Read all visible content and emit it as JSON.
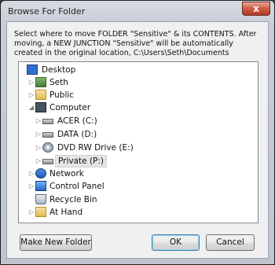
{
  "window": {
    "title": "Browse For Folder",
    "close_glyph": "x"
  },
  "description": "Select where to move FOLDER \"Sensitive\" & its CONTENTS. After moving, a NEW JUNCTION \"Sensitive\" will be automatically created in the original location, C:\\Users\\Seth\\Documents",
  "tree": {
    "items": [
      {
        "label": "Desktop",
        "icon": "desktop-icon",
        "expander": ""
      },
      {
        "label": "Seth",
        "icon": "user-folder-icon",
        "expander": "▷"
      },
      {
        "label": "Public",
        "icon": "folder-icon",
        "expander": "▷"
      },
      {
        "label": "Computer",
        "icon": "computer-icon",
        "expander": "◢"
      },
      {
        "label": "ACER (C:)",
        "icon": "drive-icon",
        "expander": "▷"
      },
      {
        "label": "DATA (D:)",
        "icon": "drive-icon",
        "expander": "▷"
      },
      {
        "label": "DVD RW Drive (E:)",
        "icon": "dvd-drive-icon",
        "expander": "▷"
      },
      {
        "label": "Private (P:)",
        "icon": "drive-icon",
        "expander": "▷",
        "selected": true
      },
      {
        "label": "Network",
        "icon": "network-icon",
        "expander": "▷"
      },
      {
        "label": "Control Panel",
        "icon": "control-panel-icon",
        "expander": "▷"
      },
      {
        "label": "Recycle Bin",
        "icon": "recycle-bin-icon",
        "expander": ""
      },
      {
        "label": "At Hand",
        "icon": "folder-icon",
        "expander": "▷"
      }
    ]
  },
  "buttons": {
    "make_new_folder": "Make New Folder",
    "ok": "OK",
    "cancel": "Cancel"
  }
}
